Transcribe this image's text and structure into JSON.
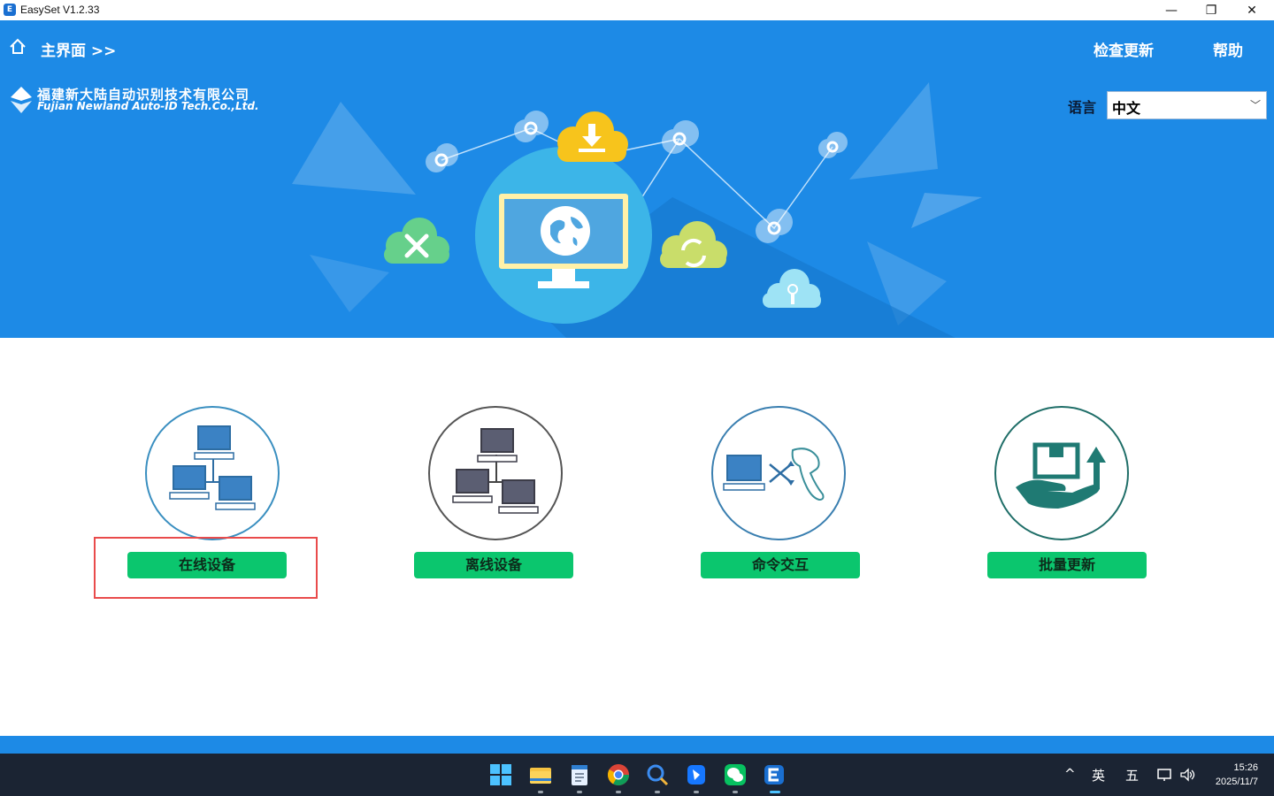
{
  "window": {
    "title": "EasySet V1.2.33",
    "icon": "easyset-app-icon",
    "controls": {
      "minimize": "—",
      "restore": "❐",
      "close": "✕"
    }
  },
  "header": {
    "home_icon": "home-icon",
    "breadcrumb": "主界面 >>",
    "check_update": "检查更新",
    "help": "帮助"
  },
  "company": {
    "name_cn": "福建新大陆自动识别技术有限公司",
    "name_en": "Fujian Newland Auto-ID Tech.Co.,Ltd."
  },
  "language": {
    "label": "语言",
    "selected": "中文"
  },
  "features": [
    {
      "label": "在线设备",
      "icon": "online-devices-network-icon",
      "highlighted": true
    },
    {
      "label": "离线设备",
      "icon": "offline-devices-network-icon",
      "highlighted": false
    },
    {
      "label": "命令交互",
      "icon": "computer-scanner-exchange-icon",
      "highlighted": false
    },
    {
      "label": "批量更新",
      "icon": "hand-box-upload-icon",
      "highlighted": false
    }
  ],
  "taskbar": {
    "apps": [
      "windows-start-icon",
      "file-explorer-icon",
      "notepad-icon",
      "chrome-icon",
      "search-app-icon",
      "feishu-icon",
      "wechat-icon",
      "easyset-icon"
    ],
    "tray": {
      "chevron": "^",
      "ime_lang": "英",
      "ime_mode": "五"
    },
    "time": "15:26",
    "date": "2025/11/7"
  },
  "colors": {
    "banner": "#1d8ae6",
    "button": "#0bc66e",
    "highlight_border": "#e94b4b",
    "taskbar": "#1b2433"
  }
}
